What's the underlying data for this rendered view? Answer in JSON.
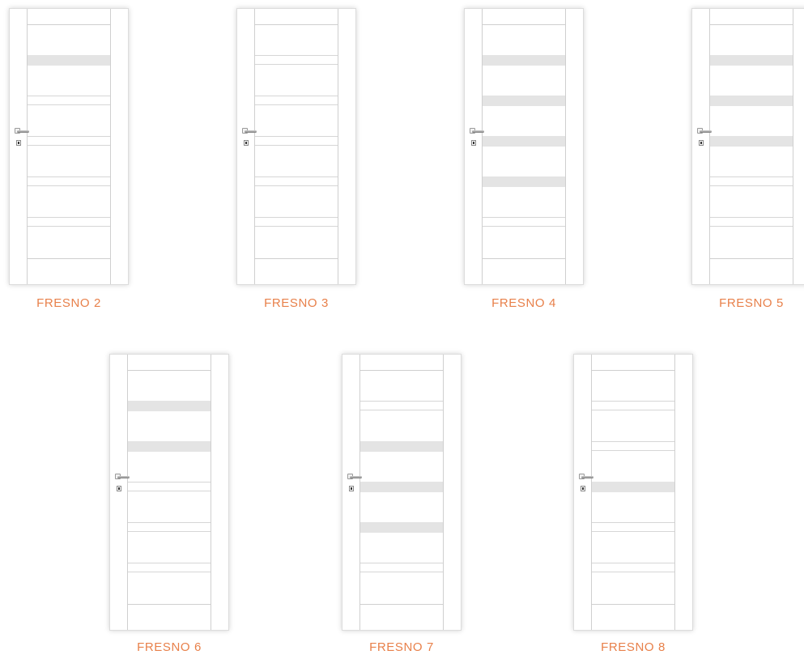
{
  "doors": [
    {
      "name": "FRESNO 2",
      "panels": [
        "glass",
        "groove",
        "groove",
        "groove",
        "groove"
      ]
    },
    {
      "name": "FRESNO 3",
      "panels": [
        "groove",
        "groove",
        "groove",
        "groove",
        "groove"
      ]
    },
    {
      "name": "FRESNO 4",
      "panels": [
        "glass",
        "glass",
        "glass",
        "glass",
        "groove"
      ]
    },
    {
      "name": "FRESNO 5",
      "panels": [
        "glass",
        "glass",
        "glass",
        "groove",
        "groove"
      ]
    },
    {
      "name": "FRESNO 6",
      "panels": [
        "glass",
        "glass",
        "groove",
        "groove",
        "groove"
      ]
    },
    {
      "name": "FRESNO 7",
      "panels": [
        "groove",
        "glass",
        "glass",
        "glass",
        "groove"
      ]
    },
    {
      "name": "FRESNO 8",
      "panels": [
        "groove",
        "groove",
        "glass",
        "groove",
        "groove"
      ]
    }
  ]
}
